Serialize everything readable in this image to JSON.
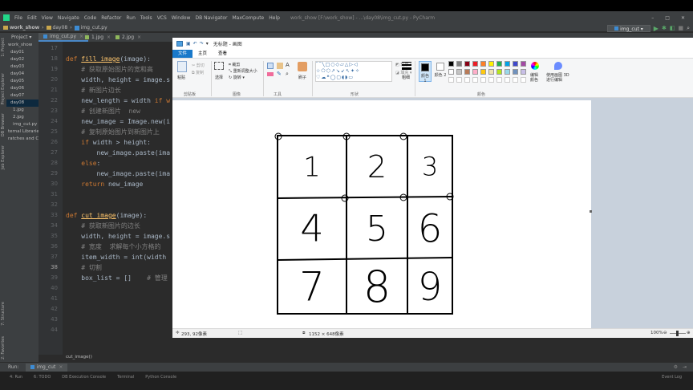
{
  "pycharm": {
    "menu": [
      "File",
      "Edit",
      "View",
      "Navigate",
      "Code",
      "Refactor",
      "Run",
      "Tools",
      "VCS",
      "Window",
      "DB Navigator",
      "MaxCompute",
      "Help"
    ],
    "window_title": "work_show [F:\\work_show] - ...\\day08\\img_cut.py - PyCharm",
    "nav": [
      "work_show",
      "day08",
      "img_cut.py"
    ],
    "run_config": "img_cut",
    "tabs": [
      "img_cut.py",
      "1.jpg",
      "2.jpg"
    ],
    "tree": [
      {
        "label": "work_show",
        "indent": 0
      },
      {
        "label": "day01",
        "indent": 1
      },
      {
        "label": "day02",
        "indent": 1
      },
      {
        "label": "day03",
        "indent": 1
      },
      {
        "label": "day04",
        "indent": 1
      },
      {
        "label": "day05",
        "indent": 1
      },
      {
        "label": "day06",
        "indent": 1
      },
      {
        "label": "day07",
        "indent": 1
      },
      {
        "label": "day08",
        "indent": 1,
        "selected": true
      },
      {
        "label": "1.jpg",
        "indent": 2
      },
      {
        "label": "2.jpg",
        "indent": 2
      },
      {
        "label": "img_cut.py",
        "indent": 2
      },
      {
        "label": "ternal Libraries",
        "indent": 0
      },
      {
        "label": "ratches and Co",
        "indent": 0
      }
    ],
    "side_tabs": [
      "1: Project",
      "Project Explorer",
      "DB Browser",
      "Job Explorer"
    ],
    "side_tabs_bottom": [
      "7: Structure",
      "2: Favorites"
    ],
    "line_numbers": [
      "17",
      "18",
      "19",
      "20",
      "21",
      "22",
      "23",
      "24",
      "25",
      "26",
      "27",
      "28",
      "29",
      "30",
      "31",
      "32",
      "33",
      "34",
      "35",
      "36",
      "37",
      "38",
      "39",
      "40",
      "41",
      "42",
      "43",
      "44"
    ],
    "code": [
      {
        "n": "17",
        "parts": []
      },
      {
        "n": "18",
        "parts": [
          {
            "t": "def ",
            "c": "kw"
          },
          {
            "t": "fill_image",
            "c": "fn"
          },
          {
            "t": "(image):",
            "c": ""
          }
        ]
      },
      {
        "n": "19",
        "parts": [
          {
            "t": "    # 获取原始图片的宽和高",
            "c": "cm"
          }
        ]
      },
      {
        "n": "20",
        "parts": [
          {
            "t": "    width, height = image.s",
            "c": ""
          }
        ]
      },
      {
        "n": "21",
        "parts": [
          {
            "t": "    # 新图片边长",
            "c": "cm"
          }
        ]
      },
      {
        "n": "22",
        "parts": [
          {
            "t": "    new_length = width ",
            "c": ""
          },
          {
            "t": "if w",
            "c": "kw"
          }
        ]
      },
      {
        "n": "23",
        "parts": [
          {
            "t": "    # 创建新图片  new",
            "c": "cm"
          }
        ]
      },
      {
        "n": "24",
        "parts": [
          {
            "t": "    new_image = Image.new(i",
            "c": ""
          }
        ]
      },
      {
        "n": "25",
        "parts": [
          {
            "t": "    # 复制原始图片到新图片上",
            "c": "cm"
          }
        ]
      },
      {
        "n": "26",
        "parts": [
          {
            "t": "    ",
            "c": ""
          },
          {
            "t": "if",
            "c": "kw"
          },
          {
            "t": " width > height:",
            "c": ""
          }
        ]
      },
      {
        "n": "27",
        "parts": [
          {
            "t": "        new_image.paste(ima",
            "c": ""
          }
        ]
      },
      {
        "n": "28",
        "parts": [
          {
            "t": "    ",
            "c": ""
          },
          {
            "t": "else",
            "c": "kw"
          },
          {
            "t": ":",
            "c": ""
          }
        ]
      },
      {
        "n": "29",
        "parts": [
          {
            "t": "        new_image.paste(ima",
            "c": ""
          }
        ]
      },
      {
        "n": "30",
        "parts": [
          {
            "t": "    ",
            "c": ""
          },
          {
            "t": "return",
            "c": "kw"
          },
          {
            "t": " new_image",
            "c": ""
          }
        ]
      },
      {
        "n": "31",
        "parts": []
      },
      {
        "n": "32",
        "parts": []
      },
      {
        "n": "33",
        "parts": [
          {
            "t": "def ",
            "c": "kw"
          },
          {
            "t": "cut_image",
            "c": "fn"
          },
          {
            "t": "(image):",
            "c": ""
          }
        ]
      },
      {
        "n": "34",
        "parts": [
          {
            "t": "    # 获取新图片的边长",
            "c": "cm"
          }
        ]
      },
      {
        "n": "35",
        "parts": [
          {
            "t": "    width, height = image.s",
            "c": ""
          }
        ]
      },
      {
        "n": "36",
        "parts": [
          {
            "t": "    # 宽度  求解每个小方格的",
            "c": "cm"
          }
        ]
      },
      {
        "n": "37",
        "parts": [
          {
            "t": "    item_width = int(width",
            "c": ""
          }
        ]
      },
      {
        "n": "38",
        "parts": [
          {
            "t": "    # 切割",
            "c": "cm"
          }
        ]
      },
      {
        "n": "39",
        "parts": [
          {
            "t": "    box_list = []    ",
            "c": ""
          },
          {
            "t": "# 管理",
            "c": "cm"
          }
        ]
      },
      {
        "n": "40",
        "parts": []
      },
      {
        "n": "41",
        "parts": []
      },
      {
        "n": "42",
        "parts": []
      },
      {
        "n": "43",
        "parts": []
      },
      {
        "n": "44",
        "parts": []
      }
    ],
    "breadcrumb": "cut_image()",
    "run_label": "Run:",
    "run_tab": "img_cut",
    "bottom_tools": [
      "4: Run",
      "6: TODO",
      "DB Execution Console",
      "Terminal",
      "Python Console"
    ],
    "event_log": "Event Log"
  },
  "paint": {
    "title": "无标题 - 画图",
    "tabs": [
      "文件",
      "主页",
      "查看"
    ],
    "groups": [
      "剪贴板",
      "图像",
      "工具",
      "形状",
      "颜色"
    ],
    "paste_label": "粘贴",
    "cut_label": "剪切",
    "copy_label": "复制",
    "select_label": "选择",
    "crop_label": "裁剪",
    "resize_label": "重新调整大小",
    "rotate_label": "旋转",
    "brush_label": "刷子",
    "outline_label": "轮廓",
    "fill_label": "填充",
    "thickness_label": "粗细",
    "color1_label": "颜色 1",
    "color2_label": "颜色 2",
    "edit_colors_label": "编辑颜色",
    "paint3d_label": "使用画图 3D 进行编辑",
    "cursor_pos": "293, 92像素",
    "canvas_size": "1152 × 648像素",
    "zoom": "100%",
    "palette": [
      "#000000",
      "#7f7f7f",
      "#880015",
      "#ed1c24",
      "#ff7f27",
      "#fff200",
      "#22b14c",
      "#00a2e8",
      "#3f48cc",
      "#a349a4",
      "#ffffff",
      "#c3c3c3",
      "#b97a57",
      "#ffaec9",
      "#ffc90e",
      "#efe4b0",
      "#b5e61d",
      "#99d9ea",
      "#7092be",
      "#c8bfe7"
    ],
    "grid_digits": [
      "1",
      "2",
      "3",
      "4",
      "5",
      "6",
      "7",
      "8",
      "9"
    ]
  }
}
